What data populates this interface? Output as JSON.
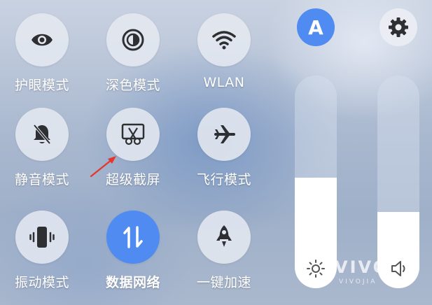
{
  "tiles": [
    {
      "label": "护眼模式",
      "icon": "eye-icon",
      "active": false
    },
    {
      "label": "深色模式",
      "icon": "dark-mode-icon",
      "active": false
    },
    {
      "label": "WLAN",
      "icon": "wifi-icon",
      "active": false
    },
    {
      "label": "静音模式",
      "icon": "mute-bell-icon",
      "active": false
    },
    {
      "label": "超级截屏",
      "icon": "screenshot-scissors-icon",
      "active": false
    },
    {
      "label": "飞行模式",
      "icon": "airplane-icon",
      "active": false
    },
    {
      "label": "振动模式",
      "icon": "vibrate-icon",
      "active": false
    },
    {
      "label": "数据网络",
      "icon": "mobile-data-icon",
      "active": true
    },
    {
      "label": "一键加速",
      "icon": "rocket-icon",
      "active": false
    }
  ],
  "auto_brightness": {
    "label": "A",
    "color": "#4f8bf0"
  },
  "settings": {
    "icon": "gear-icon"
  },
  "brightness_slider": {
    "level": 0.52,
    "icon": "sun-icon"
  },
  "volume_slider": {
    "level": 0.36,
    "icon": "speaker-icon"
  },
  "annotation": {
    "color": "#e8352b",
    "icon": "red-arrow"
  },
  "watermark": {
    "text": "VIVO",
    "sub": "VIVOJIA"
  },
  "colors": {
    "accent": "#4f8bf0",
    "label": "#ffffff"
  }
}
